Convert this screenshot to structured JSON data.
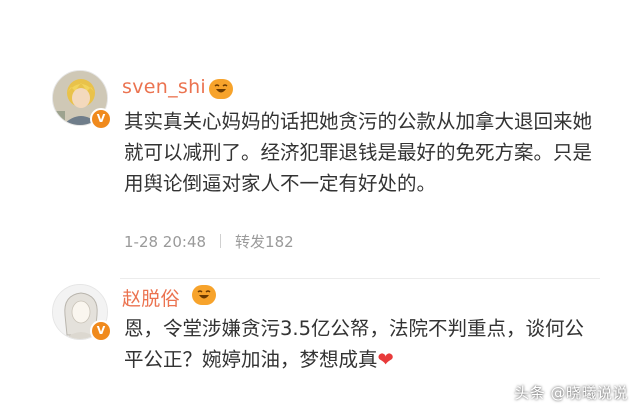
{
  "comments": [
    {
      "username": "sven_shi",
      "content": "其实真关心妈妈的话把她贪污的公款从加拿大退回来她就可以减刑了。经济犯罪退钱是最好的免死方案。只是用舆论倒逼对家人不一定有好处的。",
      "timestamp": "1-28 20:48",
      "repost_label": "转发182",
      "avatar_icon": "avatar-photo-icon",
      "badge_icon": "verified-v-icon",
      "emoji_icon": "laughing-emoji-icon"
    },
    {
      "username": "赵脱俗",
      "content": "恩，令堂涉嫌贪污3.5亿公帑，法院不判重点，谈何公平公正？婉婷加油，梦想成真",
      "heart": "❤",
      "avatar_icon": "avatar-illustration-icon",
      "badge_icon": "verified-v-icon",
      "emoji_icon": "laughing-emoji-icon"
    }
  ],
  "watermark": "头条 @晓曦说说",
  "colors": {
    "username": "#eb7350",
    "text": "#333333",
    "meta": "#9a9a9a",
    "badge": "#f08a1d",
    "heart": "#e83a3a"
  }
}
